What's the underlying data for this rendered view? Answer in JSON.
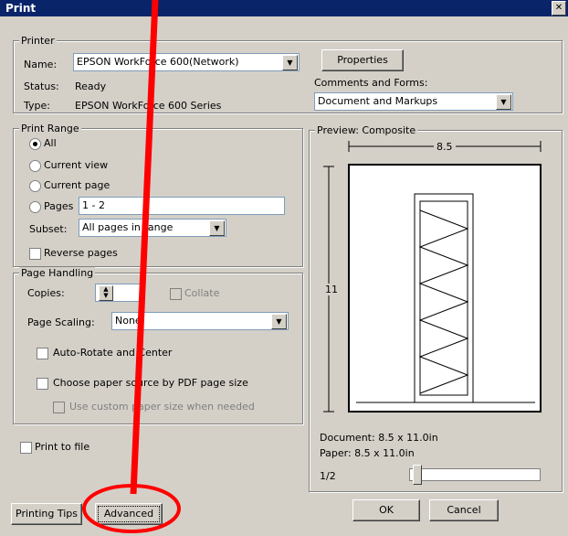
{
  "window": {
    "title": "Print",
    "close_icon": "close-icon"
  },
  "printer": {
    "group_label": "Printer",
    "name_label": "Name:",
    "name_value": "EPSON WorkForce 600(Network)",
    "status_label": "Status:",
    "status_value": "Ready",
    "type_label": "Type:",
    "type_value": "EPSON WorkForce 600 Series",
    "properties_button": "Properties",
    "comments_label": "Comments and Forms:",
    "comments_value": "Document and Markups"
  },
  "print_range": {
    "group_label": "Print Range",
    "all": "All",
    "current_view": "Current view",
    "current_page": "Current page",
    "pages": "Pages",
    "pages_value": "1 - 2",
    "subset_label": "Subset:",
    "subset_value": "All pages in range",
    "reverse_pages": "Reverse pages"
  },
  "page_handling": {
    "group_label": "Page Handling",
    "copies_label": "Copies:",
    "copies_value": "1",
    "collate": "Collate",
    "scaling_label": "Page Scaling:",
    "scaling_value": "None",
    "auto_rotate": "Auto-Rotate and Center",
    "choose_paper": "Choose paper source by PDF page size",
    "custom_paper": "Use custom paper size when needed"
  },
  "print_to_file": "Print to file",
  "preview": {
    "group_label": "Preview: Composite",
    "width_label": "8.5",
    "height_label": "11",
    "document_size": "Document: 8.5 x 11.0in",
    "paper_size": "Paper: 8.5 x 11.0in",
    "page_indicator": "1/2"
  },
  "buttons": {
    "printing_tips": "Printing Tips",
    "advanced": "Advanced",
    "ok": "OK",
    "cancel": "Cancel"
  },
  "annotation": {
    "color": "#ff0000"
  }
}
